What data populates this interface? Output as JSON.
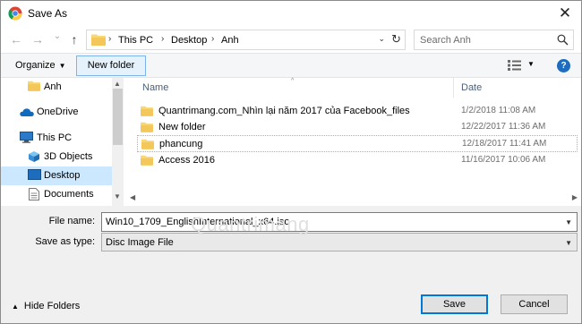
{
  "window": {
    "title": "Save As",
    "close_glyph": "✕"
  },
  "nav": {
    "back_glyph": "←",
    "forward_glyph": "→",
    "history_glyph": "⌄",
    "up_glyph": "↑",
    "path": [
      "This PC",
      "Desktop",
      "Anh"
    ],
    "separator": "›",
    "dropdown_glyph": "⌄",
    "refresh_glyph": "↻",
    "search_placeholder": "Search Anh"
  },
  "toolbar": {
    "organize_label": "Organize",
    "organize_caret": "▼",
    "new_folder_label": "New folder",
    "view_caret": "▼",
    "help_label": "?"
  },
  "sidebar": {
    "items": [
      {
        "label": "Anh",
        "icon": "folder-icon"
      },
      {
        "label": "OneDrive",
        "icon": "onedrive-cloud-icon"
      },
      {
        "label": "This PC",
        "icon": "this-pc-icon"
      },
      {
        "label": "3D Objects",
        "icon": "3d-objects-icon"
      },
      {
        "label": "Desktop",
        "icon": "desktop-icon",
        "selected": true
      },
      {
        "label": "Documents",
        "icon": "documents-icon"
      }
    ],
    "scroll_up": "▲",
    "scroll_down": "▼"
  },
  "file_list": {
    "columns": {
      "name": "Name",
      "date": "Date"
    },
    "sort_caret": "^",
    "rows": [
      {
        "name": "Quantrimang.com_Nhìn lại năm 2017 của Facebook_files",
        "date": "1/2/2018 11:08 AM"
      },
      {
        "name": "New folder",
        "date": "12/22/2017 11:36 AM"
      },
      {
        "name": "phancung",
        "date": "12/18/2017 11:41 AM",
        "focused": true
      },
      {
        "name": "Access 2016",
        "date": "11/16/2017 10:06 AM"
      }
    ],
    "scroll_left": "◀",
    "scroll_right": "▶"
  },
  "form": {
    "file_name_label": "File name:",
    "file_name_value": "Win10_1709_EnglishInternational_x64.iso",
    "save_type_label": "Save as type:",
    "save_type_value": "Disc Image File",
    "caret": "▼"
  },
  "watermark": "Quantrimang",
  "footer": {
    "hide_folders_caret": "▲",
    "hide_folders_label": "Hide Folders",
    "save_label": "Save",
    "cancel_label": "Cancel"
  },
  "colors": {
    "accent": "#0078d7",
    "folder": "#f8d775",
    "selection": "#cce8ff",
    "help": "#1e6cbe"
  }
}
